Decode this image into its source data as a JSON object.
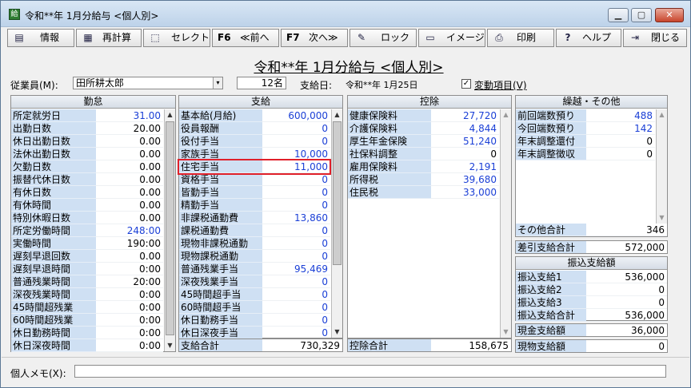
{
  "window": {
    "title": "令和**年 1月分給与 <個人別>"
  },
  "toolbar": {
    "info": "情報",
    "recalc": "再計算",
    "select": "セレクト",
    "prev_key": "F6",
    "prev": "≪前へ",
    "next_key": "F7",
    "next": "次へ≫",
    "lock": "ロック",
    "image": "イメージ",
    "print": "印刷",
    "help": "ヘルプ",
    "close": "閉じる"
  },
  "heading": "令和**年 1月分給与 <個人別>",
  "employee": {
    "label": "従業員(M):",
    "value": "田所耕太郎",
    "count": "12名",
    "paydate_label": "支給日:",
    "paydate": "令和**年 1月25日",
    "variable_label": "変動項目(V)",
    "variable_checked": true
  },
  "kintai": {
    "title": "勤怠",
    "rows": [
      {
        "k": "所定就労日",
        "v": "31.00",
        "blue": true
      },
      {
        "k": "出勤日数",
        "v": "20.00"
      },
      {
        "k": "休日出勤日数",
        "v": "0.00"
      },
      {
        "k": "法休出勤日数",
        "v": "0.00"
      },
      {
        "k": "欠勤日数",
        "v": "0.00"
      },
      {
        "k": "振替代休日数",
        "v": "0.00"
      },
      {
        "k": "有休日数",
        "v": "0.00"
      },
      {
        "k": "有休時間",
        "v": "0.00"
      },
      {
        "k": "特別休暇日数",
        "v": "0.00"
      },
      {
        "k": "所定労働時間",
        "v": "248:00",
        "blue": true
      },
      {
        "k": "実働時間",
        "v": "190:00"
      },
      {
        "k": "遅刻早退回数",
        "v": "0.00"
      },
      {
        "k": "遅刻早退時間",
        "v": "0:00"
      },
      {
        "k": "普通残業時間",
        "v": "20:00"
      },
      {
        "k": "深夜残業時間",
        "v": "0:00"
      },
      {
        "k": "45時間超残業",
        "v": "0:00"
      },
      {
        "k": "60時間超残業",
        "v": "0:00"
      },
      {
        "k": "休日勤務時間",
        "v": "0:00"
      },
      {
        "k": "休日深夜時間",
        "v": "0:00"
      }
    ]
  },
  "shikyu": {
    "title": "支給",
    "rows": [
      {
        "k": "基本給(月給)",
        "v": "600,000",
        "blue": true
      },
      {
        "k": "役員報酬",
        "v": "0",
        "blue": true
      },
      {
        "k": "役付手当",
        "v": "0",
        "blue": true
      },
      {
        "k": "家族手当",
        "v": "10,000",
        "blue": true
      },
      {
        "k": "住宅手当",
        "v": "11,000",
        "blue": true
      },
      {
        "k": "資格手当",
        "v": "0",
        "blue": true
      },
      {
        "k": "皆勤手当",
        "v": "0",
        "blue": true
      },
      {
        "k": "精勤手当",
        "v": "0",
        "blue": true
      },
      {
        "k": "非課税通勤費",
        "v": "13,860",
        "blue": true
      },
      {
        "k": "課税通勤費",
        "v": "0",
        "blue": true
      },
      {
        "k": "現物非課税通勤",
        "v": "0",
        "blue": true
      },
      {
        "k": "現物課税通勤",
        "v": "0",
        "blue": true
      },
      {
        "k": "普通残業手当",
        "v": "95,469",
        "blue": true
      },
      {
        "k": "深夜残業手当",
        "v": "0",
        "blue": true
      },
      {
        "k": "45時間超手当",
        "v": "0",
        "blue": true
      },
      {
        "k": "60時間超手当",
        "v": "0",
        "blue": true
      },
      {
        "k": "休日勤務手当",
        "v": "0",
        "blue": true
      },
      {
        "k": "休日深夜手当",
        "v": "0",
        "blue": true
      }
    ],
    "total_label": "支給合計",
    "total": "730,329"
  },
  "kojo": {
    "title": "控除",
    "rows": [
      {
        "k": "健康保険料",
        "v": "27,720",
        "blue": true
      },
      {
        "k": "介護保険料",
        "v": "4,844",
        "blue": true
      },
      {
        "k": "厚生年金保険",
        "v": "51,240",
        "blue": true
      },
      {
        "k": "社保料調整",
        "v": "0"
      },
      {
        "k": "雇用保険料",
        "v": "2,191",
        "blue": true
      },
      {
        "k": "所得税",
        "v": "39,680",
        "blue": true
      },
      {
        "k": "住民税",
        "v": "33,000",
        "blue": true
      }
    ],
    "total_label": "控除合計",
    "total": "158,675"
  },
  "kurikoshi": {
    "title": "繰越・その他",
    "rows": [
      {
        "k": "前回端数預り",
        "v": "488",
        "blue": true
      },
      {
        "k": "今回端数預り",
        "v": "142",
        "blue": true
      },
      {
        "k": "年末調整還付",
        "v": "0"
      },
      {
        "k": "年末調整徴収",
        "v": "0"
      }
    ],
    "other_label": "その他合計",
    "other": "346"
  },
  "net": {
    "label": "差引支給合計",
    "value": "572,000"
  },
  "furikomi": {
    "title": "振込支給額",
    "rows": [
      {
        "k": "振込支給1",
        "v": "536,000"
      },
      {
        "k": "振込支給2",
        "v": "0"
      },
      {
        "k": "振込支給3",
        "v": "0"
      },
      {
        "k": "振込支給合計",
        "v": "536,000"
      }
    ]
  },
  "cash": {
    "label": "現金支給額",
    "value": "36,000"
  },
  "inkind": {
    "label": "現物支給額",
    "value": "0"
  },
  "memo": {
    "label": "個人メモ(X):",
    "value": ""
  }
}
